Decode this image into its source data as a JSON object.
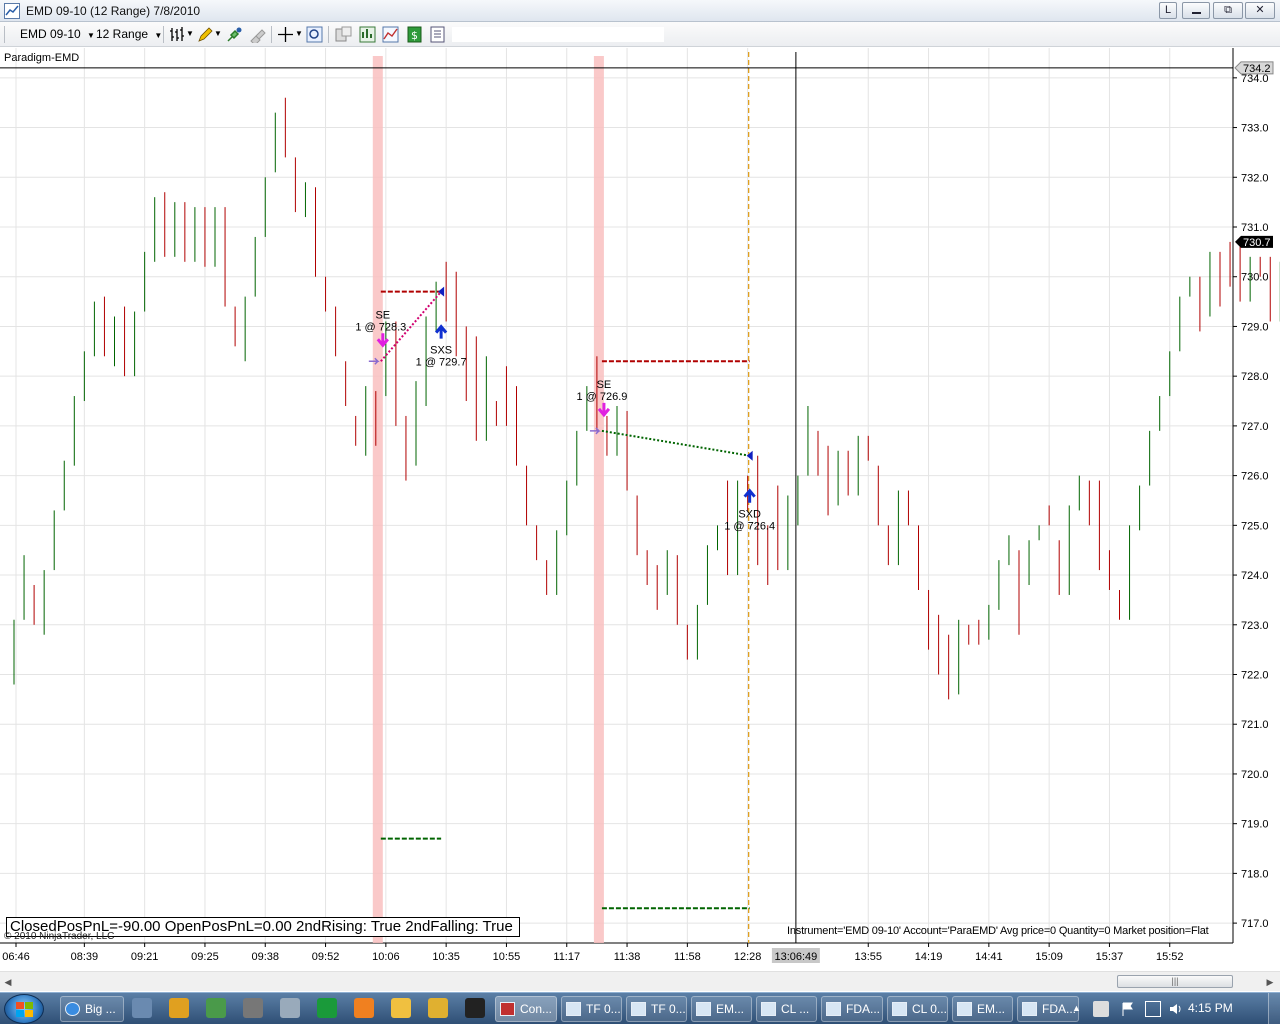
{
  "window": {
    "title": "EMD 09-10 (12 Range)  7/8/2010",
    "min_label": "L",
    "restore_label": "▭",
    "maximize_label": "⧉",
    "close_label": "✕"
  },
  "toolbar": {
    "instrument": "EMD 09-10",
    "period": "12 Range",
    "icons": [
      "bar-style-icon",
      "pencil-icon",
      "marker-icon",
      "erase-icon",
      "crosshair-icon",
      "zoom-icon",
      "data-box-icon",
      "properties-icon",
      "indicator-icon",
      "strategy-icon",
      "money-icon",
      "template-icon"
    ]
  },
  "chart": {
    "label": "Paradigm-EMD",
    "price_min": 716.6,
    "price_max": 734.6,
    "price_ticks": [
      "734.0",
      "733.0",
      "732.0",
      "731.0",
      "730.0",
      "729.0",
      "728.0",
      "727.0",
      "726.0",
      "725.0",
      "724.0",
      "723.0",
      "722.0",
      "721.0",
      "720.0",
      "719.0",
      "718.0",
      "717.0"
    ],
    "time_ticks": [
      {
        "label": "06:46",
        "bar": 0.2
      },
      {
        "label": "08:39",
        "bar": 7
      },
      {
        "label": "09:21",
        "bar": 13
      },
      {
        "label": "09:25",
        "bar": 19
      },
      {
        "label": "09:38",
        "bar": 25
      },
      {
        "label": "09:52",
        "bar": 31
      },
      {
        "label": "10:06",
        "bar": 37
      },
      {
        "label": "10:35",
        "bar": 43
      },
      {
        "label": "10:55",
        "bar": 49
      },
      {
        "label": "11:17",
        "bar": 55
      },
      {
        "label": "11:38",
        "bar": 61
      },
      {
        "label": "11:58",
        "bar": 67
      },
      {
        "label": "12:28",
        "bar": 73
      },
      {
        "label": "13:55",
        "bar": 85
      },
      {
        "label": "14:19",
        "bar": 91
      },
      {
        "label": "14:41",
        "bar": 97
      },
      {
        "label": "15:09",
        "bar": 103
      },
      {
        "label": "15:37",
        "bar": 109
      },
      {
        "label": "15:52",
        "bar": 115
      }
    ],
    "crosshair": {
      "price": "734.2",
      "time": "13:06:49",
      "bar": 77.8
    },
    "last_price": "730.7",
    "last_price_value": 730.7,
    "highlight_bars": [
      36.2,
      58.2
    ],
    "exit_line_bar": 73.1,
    "trades": [
      {
        "entry_label": "SE",
        "entry_detail": "1 @ 728.3",
        "entry_bar": 36.5,
        "entry_price": 728.3,
        "exit_label": "SXS",
        "exit_detail": "1 @ 729.7",
        "exit_bar": 42.5,
        "exit_price": 729.7,
        "stop_price": 729.7,
        "target_price": 718.7,
        "line_color": "#d0006f"
      },
      {
        "entry_label": "SE",
        "entry_detail": "1 @ 726.9",
        "entry_bar": 58.5,
        "entry_price": 726.9,
        "exit_label": "SXD",
        "exit_detail": "1 @ 726.4",
        "exit_bar": 73.2,
        "exit_price": 726.4,
        "stop_price": 728.3,
        "target_price": 717.3,
        "line_color": "#006400"
      }
    ],
    "pnl_text": "ClosedPosPnL=-90.00 OpenPosPnL=0.00 2ndRising: True 2ndFalling: True",
    "copyright": "© 2010 NinjaTrader, LLC",
    "instrument_info": "Instrument='EMD 09-10' Account='ParaEMD' Avg price=0 Quantity=0 Market position=Flat",
    "up_color": "#006400",
    "down_color": "#b00000",
    "scroll_thumb_label": "|||"
  },
  "chart_data": {
    "type": "candlestick",
    "x_unit": "bar index (12 Range bars)",
    "y_unit": "price",
    "bars": [
      [
        722.8,
        721.8,
        723.0,
        723.1
      ],
      [
        723.1,
        723.1,
        724.4,
        724.4
      ],
      [
        724.6,
        723.0,
        723.0,
        723.8
      ],
      [
        723.8,
        722.8,
        723.8,
        724.1
      ],
      [
        724.1,
        724.1,
        725.3,
        725.3
      ],
      [
        725.3,
        725.3,
        726.2,
        726.3
      ],
      [
        726.2,
        726.2,
        727.4,
        727.6
      ],
      [
        727.5,
        727.5,
        728.5,
        728.5
      ],
      [
        728.4,
        728.4,
        729.5,
        729.5
      ],
      [
        729.6,
        728.4,
        728.4,
        729.6
      ],
      [
        728.5,
        728.2,
        729.2,
        729.2
      ],
      [
        729.1,
        728.0,
        728.0,
        729.4
      ],
      [
        728.0,
        728.0,
        729.3,
        729.3
      ],
      [
        729.3,
        729.3,
        730.5,
        730.5
      ],
      [
        730.3,
        730.3,
        731.6,
        731.6
      ],
      [
        731.7,
        730.4,
        730.4,
        731.7
      ],
      [
        730.4,
        730.4,
        731.5,
        731.5
      ],
      [
        731.5,
        730.3,
        730.3,
        731.5
      ],
      [
        730.3,
        730.3,
        731.4,
        731.4
      ],
      [
        731.3,
        730.2,
        730.2,
        731.4
      ],
      [
        730.2,
        730.2,
        731.4,
        731.4
      ],
      [
        731.4,
        729.4,
        729.4,
        731.4
      ],
      [
        729.4,
        728.6,
        728.6,
        729.4
      ],
      [
        728.3,
        728.3,
        729.6,
        729.6
      ],
      [
        729.6,
        729.6,
        730.8,
        730.8
      ],
      [
        730.8,
        730.8,
        732.0,
        732.0
      ],
      [
        732.1,
        732.1,
        733.3,
        733.3
      ],
      [
        733.6,
        732.4,
        732.4,
        733.6
      ],
      [
        732.4,
        731.3,
        731.3,
        732.4
      ],
      [
        731.2,
        731.2,
        731.9,
        731.9
      ],
      [
        731.8,
        730.0,
        730.0,
        731.8
      ],
      [
        730.0,
        729.3,
        729.3,
        730.0
      ],
      [
        729.4,
        728.4,
        728.4,
        729.4
      ],
      [
        728.3,
        727.4,
        727.4,
        728.3
      ],
      [
        727.2,
        726.6,
        726.6,
        727.2
      ],
      [
        726.4,
        726.4,
        727.8,
        727.8
      ],
      [
        727.7,
        726.6,
        726.6,
        727.7
      ],
      [
        727.6,
        727.6,
        728.9,
        729.1
      ],
      [
        728.9,
        727.0,
        727.2,
        729.1
      ],
      [
        727.1,
        725.9,
        726.2,
        727.2
      ],
      [
        726.2,
        726.2,
        727.9,
        727.9
      ],
      [
        727.4,
        727.4,
        729.2,
        729.2
      ],
      [
        729.1,
        728.9,
        729.8,
        729.9
      ],
      [
        730.3,
        729.1,
        729.1,
        730.3
      ],
      [
        729.1,
        728.4,
        728.4,
        730.1
      ],
      [
        728.4,
        727.5,
        727.5,
        729.0
      ],
      [
        727.5,
        726.7,
        726.7,
        728.8
      ],
      [
        726.7,
        726.7,
        727.5,
        728.4
      ],
      [
        727.5,
        727.0,
        727.0,
        727.5
      ],
      [
        728.1,
        727.0,
        727.0,
        728.2
      ],
      [
        727.0,
        726.2,
        726.2,
        727.8
      ],
      [
        726.2,
        725.0,
        725.0,
        726.2
      ],
      [
        725.0,
        724.3,
        724.3,
        725.0
      ],
      [
        724.3,
        723.6,
        723.6,
        724.3
      ],
      [
        723.6,
        723.6,
        724.9,
        724.9
      ],
      [
        724.8,
        724.8,
        725.9,
        725.9
      ],
      [
        725.8,
        725.8,
        726.9,
        726.9
      ],
      [
        726.9,
        726.9,
        727.8,
        727.8
      ],
      [
        728.3,
        726.9,
        727.2,
        728.4
      ],
      [
        727.2,
        726.4,
        726.4,
        727.2
      ],
      [
        726.4,
        726.4,
        727.3,
        727.4
      ],
      [
        727.3,
        725.7,
        725.7,
        727.3
      ],
      [
        725.6,
        724.4,
        724.5,
        725.6
      ],
      [
        724.5,
        723.8,
        723.8,
        724.5
      ],
      [
        723.8,
        723.3,
        723.3,
        724.2
      ],
      [
        723.6,
        723.6,
        724.5,
        724.5
      ],
      [
        724.4,
        723.0,
        723.0,
        724.4
      ],
      [
        723.0,
        722.3,
        722.3,
        723.0
      ],
      [
        722.3,
        722.3,
        723.4,
        723.4
      ],
      [
        723.4,
        723.4,
        724.6,
        724.6
      ],
      [
        724.5,
        724.5,
        725.0,
        725.0
      ],
      [
        724.9,
        724.0,
        724.0,
        725.9
      ],
      [
        724.0,
        724.0,
        725.9,
        725.9
      ],
      [
        725.9,
        725.3,
        725.3,
        726.0
      ],
      [
        725.3,
        724.2,
        724.2,
        726.4
      ],
      [
        725.0,
        723.8,
        723.8,
        725.0
      ],
      [
        724.8,
        724.1,
        724.1,
        725.8
      ],
      [
        724.1,
        724.1,
        725.0,
        725.6
      ],
      [
        725.0,
        725.0,
        726.0,
        726.0
      ],
      [
        726.0,
        726.0,
        727.4,
        727.4
      ],
      [
        726.9,
        726.0,
        726.0,
        726.9
      ],
      [
        726.6,
        726.6,
        725.2,
        725.2
      ],
      [
        725.4,
        725.4,
        726.5,
        726.5
      ],
      [
        726.5,
        725.6,
        725.6,
        726.5
      ],
      [
        725.6,
        725.6,
        726.8,
        726.8
      ],
      [
        726.8,
        726.8,
        726.3,
        726.3
      ],
      [
        726.2,
        725.0,
        725.0,
        726.2
      ],
      [
        725.0,
        724.2,
        724.2,
        725.0
      ],
      [
        724.2,
        724.2,
        725.7,
        725.7
      ],
      [
        725.7,
        725.0,
        725.0,
        725.7
      ],
      [
        725.0,
        723.7,
        723.7,
        725.0
      ],
      [
        723.7,
        722.5,
        722.5,
        723.7
      ],
      [
        722.5,
        722.0,
        722.0,
        723.2
      ],
      [
        722.0,
        721.5,
        721.5,
        722.8
      ],
      [
        721.5,
        721.6,
        722.6,
        723.1
      ],
      [
        722.6,
        722.6,
        721.7,
        723.0
      ],
      [
        723.0,
        722.6,
        722.6,
        723.1
      ],
      [
        722.6,
        722.7,
        723.3,
        723.4
      ],
      [
        723.3,
        723.3,
        724.3,
        724.3
      ],
      [
        724.2,
        724.2,
        724.8,
        724.8
      ],
      [
        724.5,
        722.8,
        723.8,
        724.5
      ],
      [
        723.8,
        723.8,
        724.7,
        724.7
      ],
      [
        724.7,
        724.7,
        725.0,
        725.0
      ],
      [
        725.0,
        725.0,
        724.0,
        725.4
      ],
      [
        724.0,
        723.6,
        723.6,
        724.7
      ],
      [
        723.6,
        723.6,
        725.4,
        725.4
      ],
      [
        725.3,
        725.3,
        726.0,
        726.0
      ],
      [
        725.9,
        725.0,
        725.0,
        725.9
      ],
      [
        725.0,
        724.1,
        724.1,
        725.9
      ],
      [
        724.1,
        723.7,
        723.7,
        724.5
      ],
      [
        723.7,
        723.1,
        723.1,
        723.7
      ],
      [
        723.1,
        723.1,
        725.0,
        725.0
      ],
      [
        724.9,
        724.9,
        725.8,
        725.8
      ],
      [
        725.8,
        725.8,
        726.9,
        726.9
      ],
      [
        726.9,
        726.9,
        727.6,
        727.6
      ],
      [
        727.6,
        727.6,
        728.5,
        728.5
      ],
      [
        728.5,
        728.5,
        729.6,
        729.6
      ],
      [
        729.6,
        729.6,
        730.0,
        730.0
      ],
      [
        730.0,
        728.9,
        728.9,
        730.0
      ],
      [
        729.2,
        729.2,
        730.5,
        730.5
      ],
      [
        730.5,
        729.4,
        729.4,
        730.5
      ],
      [
        730.7,
        729.8,
        729.8,
        730.7
      ],
      [
        730.8,
        729.5,
        729.5,
        730.8
      ],
      [
        729.5,
        729.5,
        730.4,
        730.4
      ],
      [
        730.4,
        730.0,
        730.0,
        730.4
      ],
      [
        730.0,
        729.1,
        729.1,
        730.4
      ],
      [
        729.1,
        729.1,
        730.3,
        730.3
      ],
      [
        730.3,
        730.3,
        731.2,
        731.2
      ],
      [
        731.3,
        731.3,
        730.7,
        731.5
      ],
      [
        730.6,
        730.5,
        730.7,
        731.7
      ]
    ],
    "bar_format": "[open, low, close, high]",
    "ylim": [
      716.6,
      734.6
    ]
  },
  "taskbar": {
    "items": [
      {
        "label": "Big ...",
        "active": false
      },
      {
        "label": "Con...",
        "active": true
      },
      {
        "label": "TF 0...",
        "active": false
      },
      {
        "label": "TF 0...",
        "active": false
      },
      {
        "label": "EM...",
        "active": false
      },
      {
        "label": "CL ...",
        "active": false
      },
      {
        "label": "FDA...",
        "active": false
      },
      {
        "label": "CL 0...",
        "active": false
      },
      {
        "label": "EM...",
        "active": false
      },
      {
        "label": "FDA...",
        "active": false
      }
    ],
    "clock": "4:15 PM"
  }
}
